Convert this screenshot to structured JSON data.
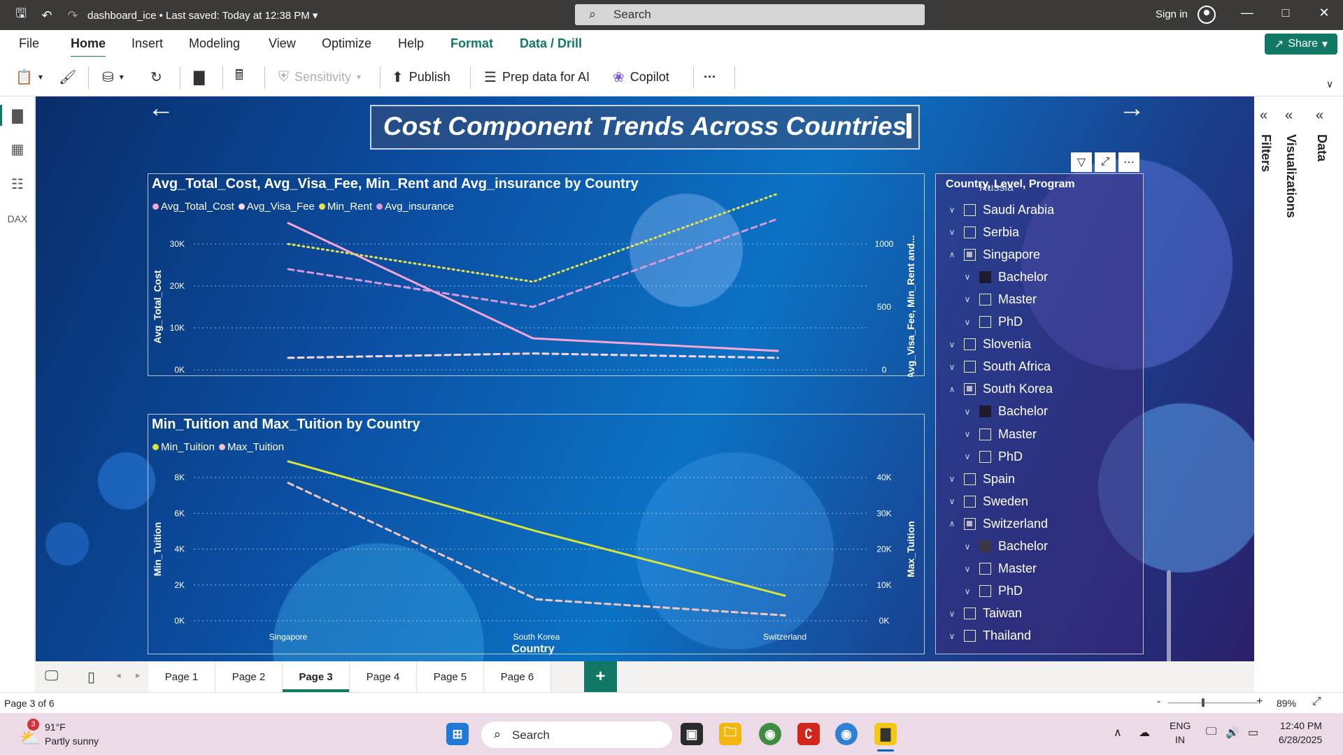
{
  "window": {
    "doc_title": "dashboard_ice",
    "saved_status": "Last saved: Today at 12:38 PM",
    "search_placeholder": "Search",
    "sign_in": "Sign in"
  },
  "menu": {
    "tabs": [
      "File",
      "Home",
      "Insert",
      "Modeling",
      "View",
      "Optimize",
      "Help",
      "Format",
      "Data / Drill"
    ],
    "share": "Share"
  },
  "ribbon": {
    "sensitivity": "Sensitivity",
    "publish": "Publish",
    "prep_data": "Prep data for AI",
    "copilot": "Copilot",
    "more": "···"
  },
  "report": {
    "title": "Cost Component Trends Across Countries"
  },
  "chart_data": [
    {
      "type": "line",
      "title": "Avg_Total_Cost, Avg_Visa_Fee, Min_Rent and Avg_insurance by Country",
      "categories": [
        "Singapore",
        "South Korea",
        "Switzerland"
      ],
      "xlabel": "Country",
      "ylabel": "Avg_Total_Cost",
      "y2label": "Avg_Visa_Fee, Min_Rent and...",
      "ylim": [
        0,
        30000
      ],
      "y2lim": [
        0,
        1000
      ],
      "yticks": [
        "0K",
        "10K",
        "20K",
        "30K"
      ],
      "y2ticks": [
        "0",
        "500",
        "1000"
      ],
      "series": [
        {
          "name": "Avg_Total_Cost",
          "axis": "left",
          "color": "#f5a6d6",
          "style": "solid",
          "values": [
            35000,
            7500,
            4500
          ]
        },
        {
          "name": "Avg_Visa_Fee",
          "axis": "right",
          "color": "#f7d7e4",
          "style": "dashed",
          "values": [
            95,
            130,
            95
          ]
        },
        {
          "name": "Min_Rent",
          "axis": "right",
          "color": "#e6e34a",
          "style": "dotted",
          "values": [
            1000,
            700,
            1400
          ]
        },
        {
          "name": "Avg_insurance",
          "axis": "right",
          "color": "#d79ad8",
          "style": "dashed",
          "values": [
            800,
            500,
            1200
          ]
        }
      ]
    },
    {
      "type": "line",
      "title": "Min_Tuition and Max_Tuition by Country",
      "categories": [
        "Singapore",
        "South Korea",
        "Switzerland"
      ],
      "xlabel": "Country",
      "ylabel": "Min_Tuition",
      "y2label": "Max_Tuition",
      "ylim": [
        0,
        8000
      ],
      "y2lim": [
        0,
        40000
      ],
      "yticks": [
        "0K",
        "2K",
        "4K",
        "6K",
        "8K"
      ],
      "y2ticks": [
        "0K",
        "10K",
        "20K",
        "30K",
        "40K"
      ],
      "series": [
        {
          "name": "Min_Tuition",
          "axis": "left",
          "color": "#d7e43a",
          "style": "solid",
          "values": [
            8900,
            5000,
            1400
          ]
        },
        {
          "name": "Max_Tuition",
          "axis": "right",
          "color": "#f2c6c0",
          "style": "dashed",
          "values": [
            38500,
            6000,
            1500
          ]
        }
      ]
    }
  ],
  "slicer": {
    "header": "Country, Level, Program",
    "partial_top": "Russia",
    "rows": [
      {
        "label": "Saudi Arabia",
        "level": 0,
        "expanded": false,
        "state": "empty"
      },
      {
        "label": "Serbia",
        "level": 0,
        "expanded": false,
        "state": "empty"
      },
      {
        "label": "Singapore",
        "level": 0,
        "expanded": true,
        "state": "partial"
      },
      {
        "label": "Bachelor",
        "level": 1,
        "expanded": false,
        "state": "full"
      },
      {
        "label": "Master",
        "level": 1,
        "expanded": false,
        "state": "empty"
      },
      {
        "label": "PhD",
        "level": 1,
        "expanded": false,
        "state": "empty"
      },
      {
        "label": "Slovenia",
        "level": 0,
        "expanded": false,
        "state": "empty"
      },
      {
        "label": "South Africa",
        "level": 0,
        "expanded": false,
        "state": "empty"
      },
      {
        "label": "South Korea",
        "level": 0,
        "expanded": true,
        "state": "partial"
      },
      {
        "label": "Bachelor",
        "level": 1,
        "expanded": false,
        "state": "full"
      },
      {
        "label": "Master",
        "level": 1,
        "expanded": false,
        "state": "empty"
      },
      {
        "label": "PhD",
        "level": 1,
        "expanded": false,
        "state": "empty"
      },
      {
        "label": "Spain",
        "level": 0,
        "expanded": false,
        "state": "empty"
      },
      {
        "label": "Sweden",
        "level": 0,
        "expanded": false,
        "state": "empty"
      },
      {
        "label": "Switzerland",
        "level": 0,
        "expanded": true,
        "state": "partial"
      },
      {
        "label": "Bachelor",
        "level": 1,
        "expanded": false,
        "state": "full2"
      },
      {
        "label": "Master",
        "level": 1,
        "expanded": false,
        "state": "empty"
      },
      {
        "label": "PhD",
        "level": 1,
        "expanded": false,
        "state": "empty"
      },
      {
        "label": "Taiwan",
        "level": 0,
        "expanded": false,
        "state": "empty"
      },
      {
        "label": "Thailand",
        "level": 0,
        "expanded": false,
        "state": "empty"
      }
    ]
  },
  "panes": {
    "filters": "Filters",
    "visualizations": "Visualizations",
    "data": "Data"
  },
  "pages": {
    "tabs": [
      "Page 1",
      "Page 2",
      "Page 3",
      "Page 4",
      "Page 5",
      "Page 6"
    ],
    "active": "Page 3",
    "add": "+"
  },
  "status": {
    "page_info": "Page 3 of 6",
    "zoom": "89%",
    "zoom_minus": "-",
    "zoom_plus": "+"
  },
  "taskbar": {
    "weather_temp": "91°F",
    "weather_desc": "Partly sunny",
    "weather_badge": "3",
    "search": "Search",
    "lang": "ENG",
    "region": "IN",
    "time": "12:40 PM",
    "date": "6/28/2025"
  }
}
